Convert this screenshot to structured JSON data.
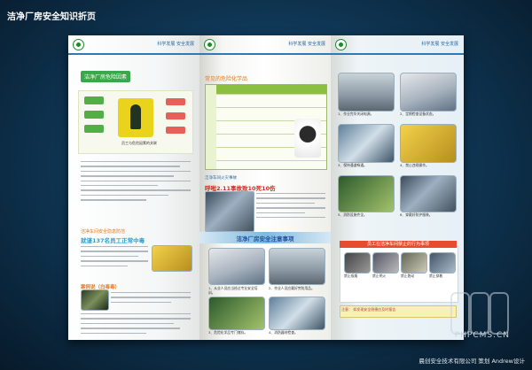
{
  "page": {
    "title": "洁净厂房安全知识折页"
  },
  "panel_header_tag": "科学发展 安全发展",
  "panel1": {
    "heading": "洁净厂房危险因素",
    "diagram_caption": "员工与危险因素的关联",
    "section2_title": "洁净车间安全隐患防范",
    "case_title": "就谨137名员工正常中毒",
    "case2_title": "案例说（白毒毒）"
  },
  "panel2": {
    "heading": "常见的危险化学品",
    "case_label": "洁净车间火灾事故",
    "case_title": "呼啦2.11事故致10死10伤",
    "banner": "洁净厂房安全注意事项",
    "captions": [
      "1、从业人员应当经过专业安全培训。",
      "2、作业人员应戴好劳防用品。",
      "3、危险化学品专门储存。",
      "4、消防器材检查。"
    ]
  },
  "panel3": {
    "warning_title": "员工在洁净车间禁止的行为事项",
    "note_label": "注意：",
    "footer_warning": "如发现安全隐患应及时报告",
    "captions": [
      "1、作业完毕关闭电源。",
      "2、定期检查设备状态。",
      "3、保持通道畅通。",
      "4、禁止违规操作。",
      "5、消防设施齐全。",
      "6、穿戴好防护服装。"
    ],
    "ban_labels": [
      "禁止吸烟",
      "禁止明火",
      "禁止跑动",
      "禁止穿着"
    ]
  },
  "watermark": "PHPCMS.CN",
  "credit": "晨创安全技术有限公司 策划 Andrew设计",
  "colors": {
    "accent_green": "#38a84a",
    "accent_red": "#d42a1d",
    "accent_blue": "#2b7ab9"
  }
}
